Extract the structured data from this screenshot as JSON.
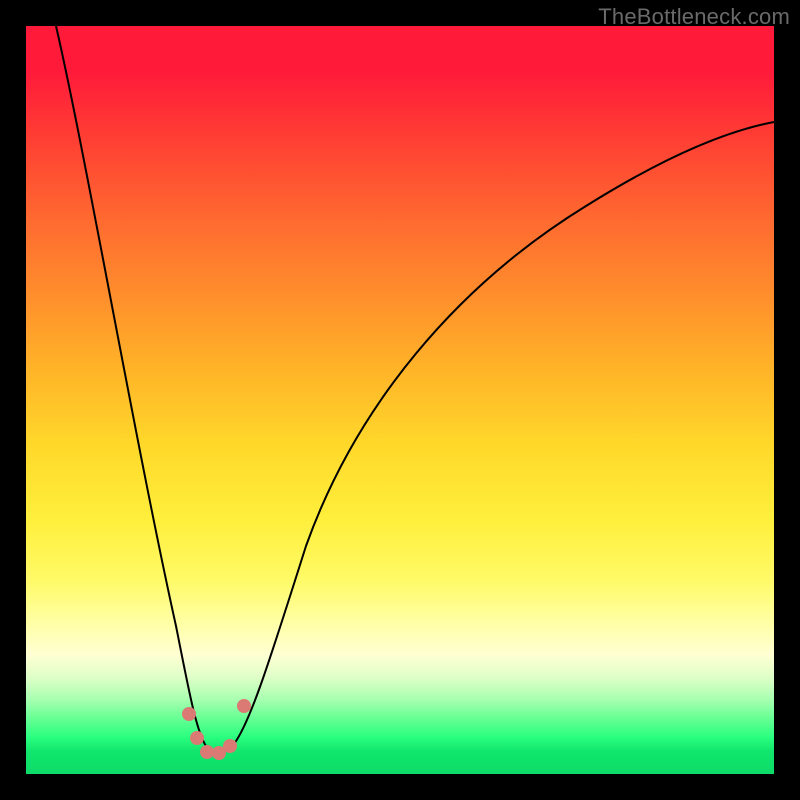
{
  "watermark": "TheBottleneck.com",
  "colors": {
    "frame_border": "#000000",
    "curve": "#000000",
    "dots": "#db7a74"
  },
  "chart_data": {
    "type": "line",
    "title": "",
    "xlabel": "",
    "ylabel": "",
    "ylim": [
      0,
      100
    ],
    "xlim": [
      0,
      100
    ],
    "x_percent": [
      4,
      8,
      12,
      16,
      18,
      20,
      22,
      23,
      24,
      25,
      26,
      28,
      30,
      34,
      40,
      50,
      60,
      70,
      80,
      90,
      100
    ],
    "y_percent": [
      100,
      78,
      56,
      34,
      22,
      12,
      6,
      3,
      2,
      2,
      3,
      7,
      14,
      28,
      42,
      56,
      66,
      74,
      80,
      84,
      87
    ],
    "valley_x_percent": 24.5,
    "dot_points": [
      {
        "x_percent": 22,
        "y_percent": 8
      },
      {
        "x_percent": 23,
        "y_percent": 4
      },
      {
        "x_percent": 24,
        "y_percent": 2.5
      },
      {
        "x_percent": 25.5,
        "y_percent": 2.5
      },
      {
        "x_percent": 27,
        "y_percent": 3.5
      },
      {
        "x_percent": 29,
        "y_percent": 9
      }
    ],
    "note": "Percent coordinates are relative to the inner plot area (748x748). y_percent is measured from the bottom (0) to the top (100) of the plot."
  }
}
